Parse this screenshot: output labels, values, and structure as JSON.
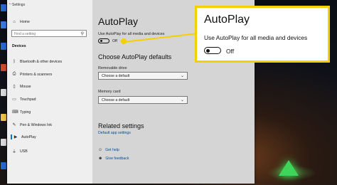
{
  "window": {
    "title": "Settings"
  },
  "sidebar": {
    "home": "Home",
    "search_placeholder": "Find a setting",
    "section": "Devices",
    "items": [
      {
        "label": "Bluetooth & other devices",
        "icon": "bluetooth-icon"
      },
      {
        "label": "Printers & scanners",
        "icon": "printer-icon"
      },
      {
        "label": "Mouse",
        "icon": "mouse-icon"
      },
      {
        "label": "Touchpad",
        "icon": "touchpad-icon"
      },
      {
        "label": "Typing",
        "icon": "keyboard-icon"
      },
      {
        "label": "Pen & Windows Ink",
        "icon": "pen-icon"
      },
      {
        "label": "AutoPlay",
        "icon": "autoplay-icon",
        "active": true
      },
      {
        "label": "USB",
        "icon": "usb-icon"
      }
    ]
  },
  "main": {
    "title": "AutoPlay",
    "use_autoplay_label": "Use AutoPlay for all media and devices",
    "toggle_state": "Off",
    "defaults_heading": "Choose AutoPlay defaults",
    "removable_label": "Removable drive",
    "removable_value": "Choose a default",
    "memory_label": "Memory card",
    "memory_value": "Choose a default",
    "related_heading": "Related settings",
    "related_link": "Default app settings",
    "get_help": "Get help",
    "give_feedback": "Give feedback"
  },
  "callout": {
    "title": "AutoPlay",
    "text": "Use AutoPlay for all media and devices",
    "toggle_state": "Off",
    "accent": "#f4d000"
  }
}
